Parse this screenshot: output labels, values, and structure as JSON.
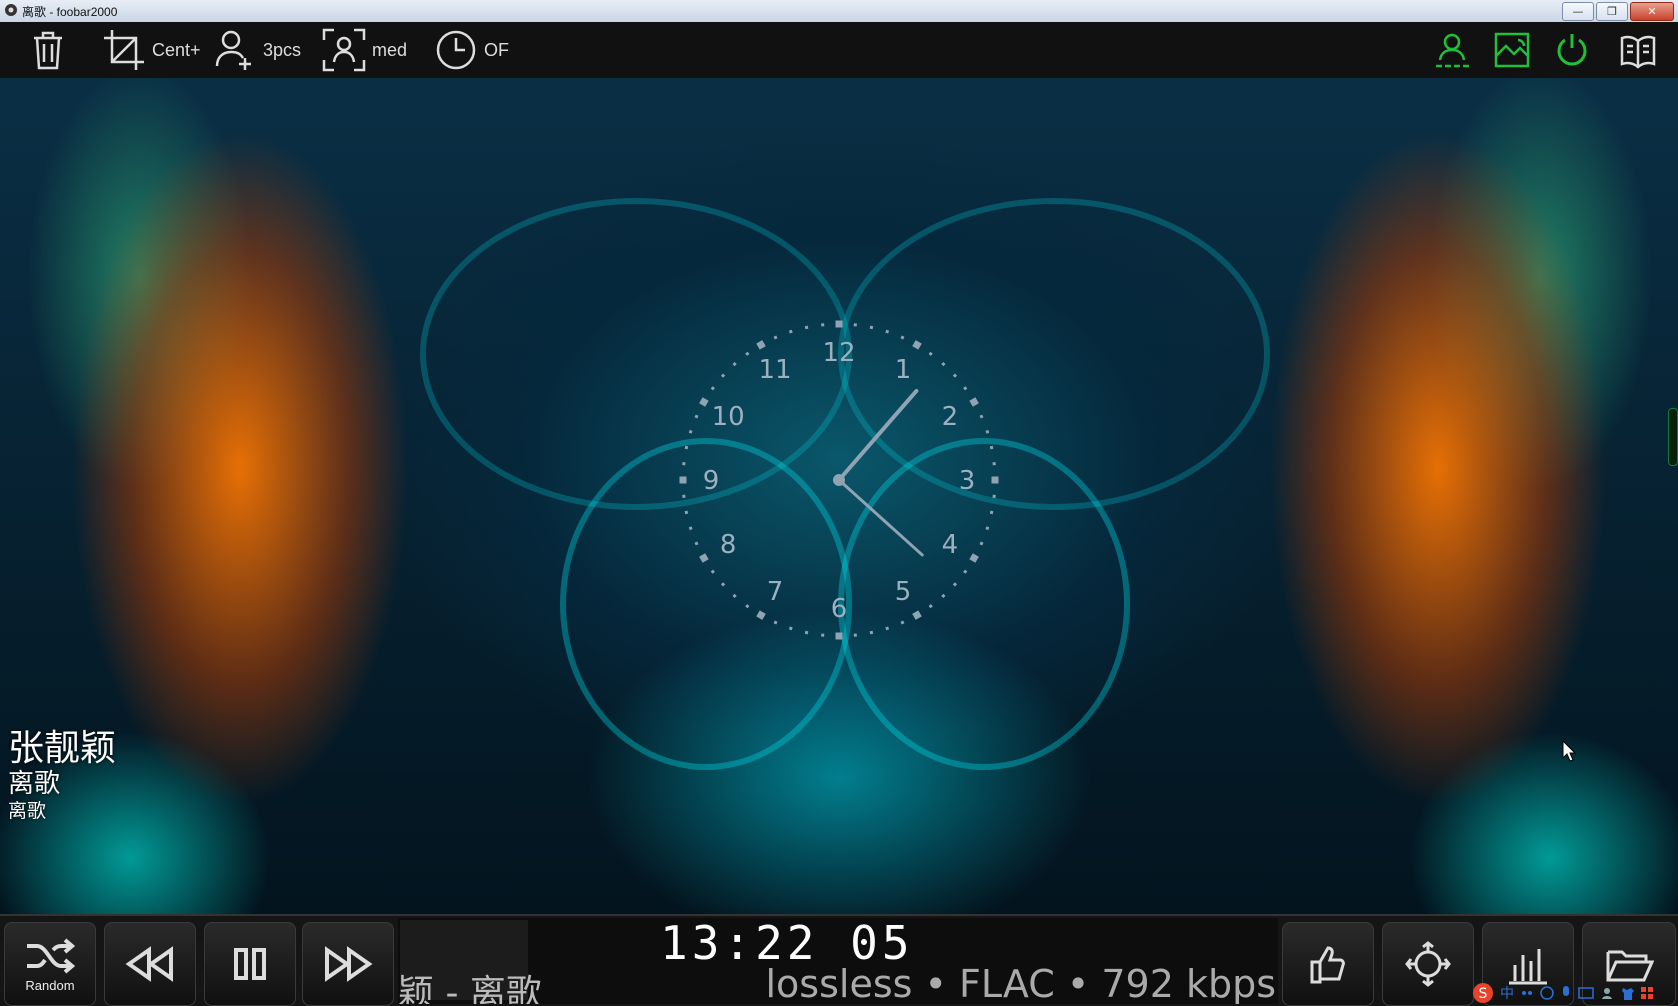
{
  "window": {
    "title": "离歌 - foobar2000",
    "minimize": "—",
    "restore": "❐",
    "close": "✕"
  },
  "toolbar": {
    "crop_label": "Cent+",
    "people_label": "3pcs",
    "face_label": "med",
    "timer_label": "OF"
  },
  "clock": {
    "numbers": [
      "12",
      "1",
      "2",
      "3",
      "4",
      "5",
      "6",
      "7",
      "8",
      "9",
      "10",
      "11"
    ],
    "hour": 13,
    "minute": 22,
    "second": 5
  },
  "track": {
    "artist": "张靓颖",
    "title": "离歌",
    "album": "离歌"
  },
  "player": {
    "random_label": "Random",
    "time": "13:22  05",
    "scroll_title": "颖 - 离歌",
    "codec_info": "lossless • FLAC • 792 kbps"
  },
  "tray": {
    "ime_label": "中"
  },
  "colors": {
    "accent_green": "#1fc03a",
    "clock_hands": "#8fa3b3"
  }
}
